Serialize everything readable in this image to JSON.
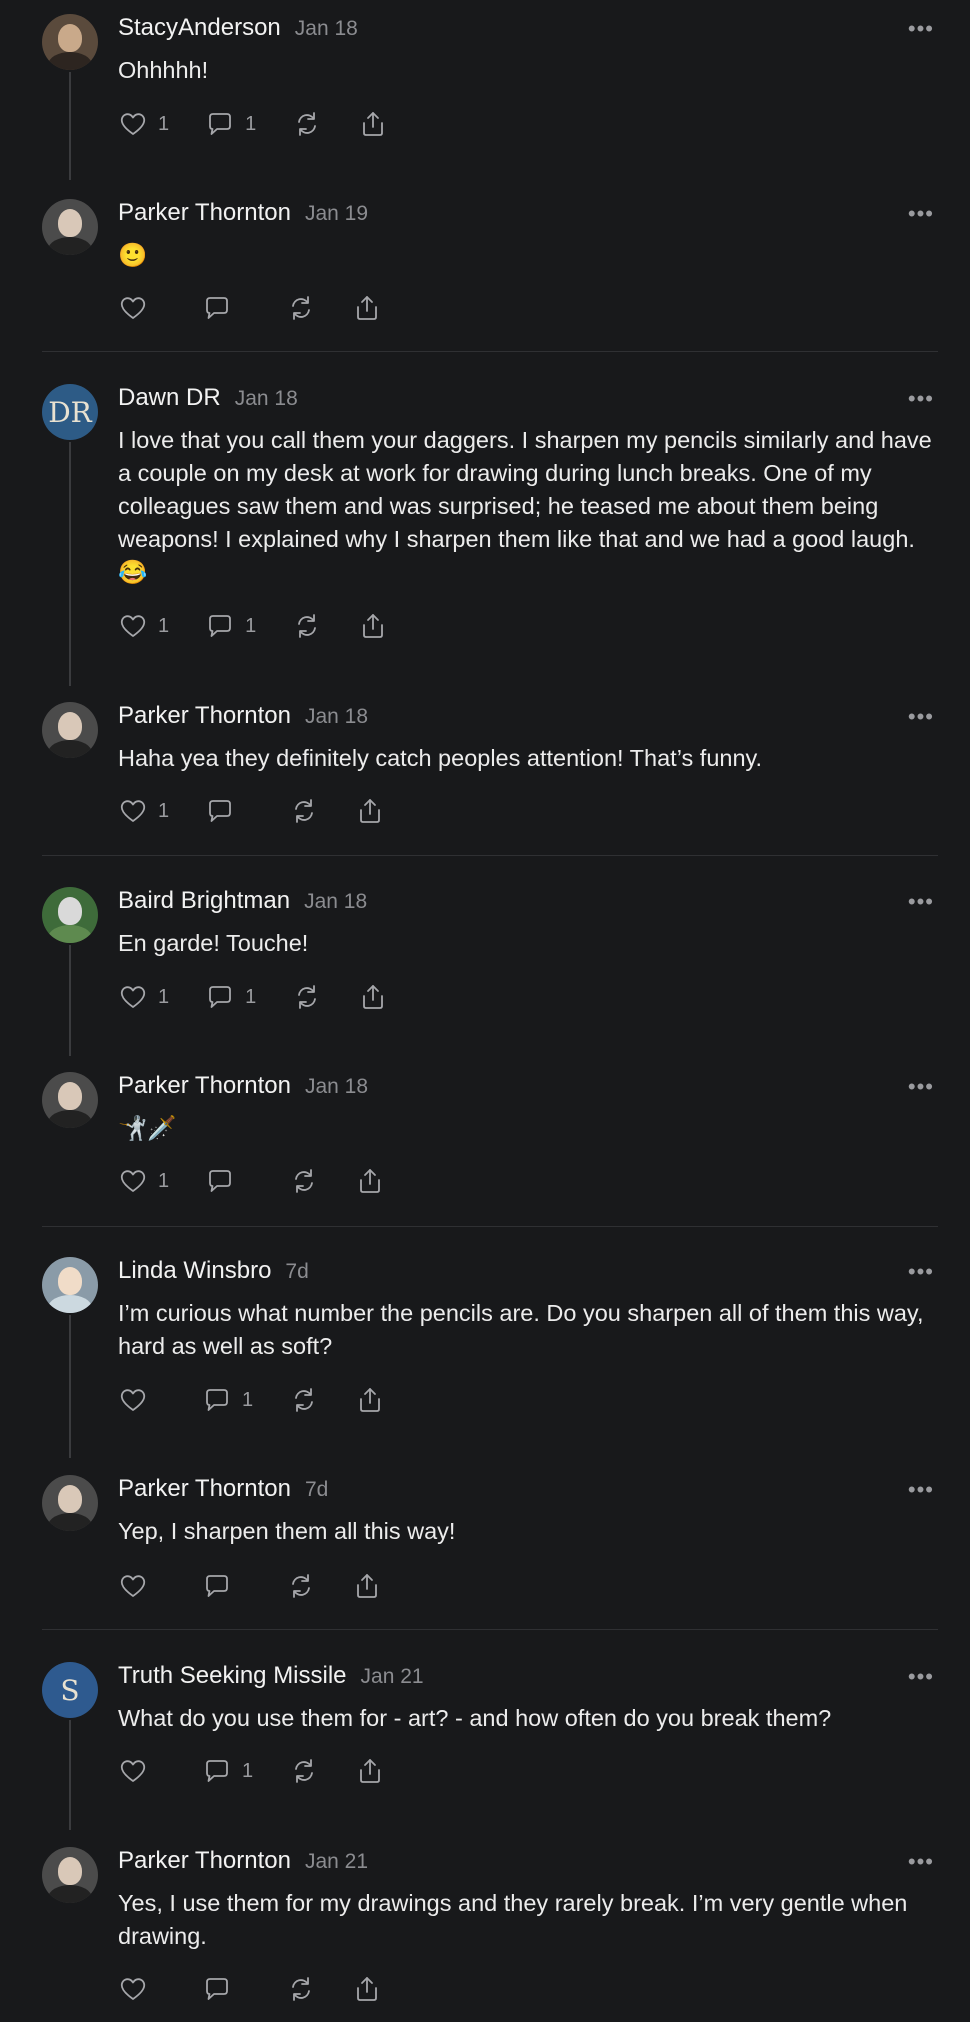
{
  "colors": {
    "background": "#18191b",
    "text": "#ececec",
    "muted": "#8b8c90",
    "divider": "#2f3033"
  },
  "icons": [
    "heart-icon",
    "comment-icon",
    "repost-icon",
    "share-icon",
    "more-icon"
  ],
  "more_label": "•••",
  "posts": [
    {
      "author": "StacyAnderson",
      "date": "Jan 18",
      "text": "Ohhhhh!",
      "likes": "1",
      "comments": "1"
    },
    {
      "author": "Parker Thornton",
      "date": "Jan 19",
      "text": "🙂",
      "likes": "",
      "comments": ""
    },
    {
      "author": "Dawn DR",
      "date": "Jan 18",
      "text": "I love that you call them your daggers. I sharpen my pencils similarly and have a couple on my desk at work for drawing during lunch breaks. One of my colleagues saw them and was surprised; he teased me about them being weapons! I explained why I sharpen them like that and we had a good laugh. 😂",
      "likes": "1",
      "comments": "1"
    },
    {
      "author": "Parker Thornton",
      "date": "Jan 18",
      "text": "Haha yea they definitely catch peoples attention! That’s funny.",
      "likes": "1",
      "comments": ""
    },
    {
      "author": "Baird Brightman",
      "date": "Jan 18",
      "text": "En garde! Touche!",
      "likes": "1",
      "comments": "1"
    },
    {
      "author": "Parker Thornton",
      "date": "Jan 18",
      "text": "🤺🗡️",
      "likes": "1",
      "comments": ""
    },
    {
      "author": "Linda Winsbro",
      "date": "7d",
      "text": "I’m curious what number the pencils are. Do you sharpen all of them this way, hard as well as soft?",
      "likes": "",
      "comments": "1"
    },
    {
      "author": "Parker Thornton",
      "date": "7d",
      "text": "Yep, I sharpen them all this way!",
      "likes": "",
      "comments": ""
    },
    {
      "author": "Truth Seeking Missile",
      "date": "Jan 21",
      "text": "What do you use them for - art? - and how often do you break them?",
      "likes": "",
      "comments": "1"
    },
    {
      "author": "Parker Thornton",
      "date": "Jan 21",
      "text": "Yes, I use them for my drawings and they rarely break. I’m very gentle when drawing.",
      "likes": "",
      "comments": ""
    }
  ]
}
